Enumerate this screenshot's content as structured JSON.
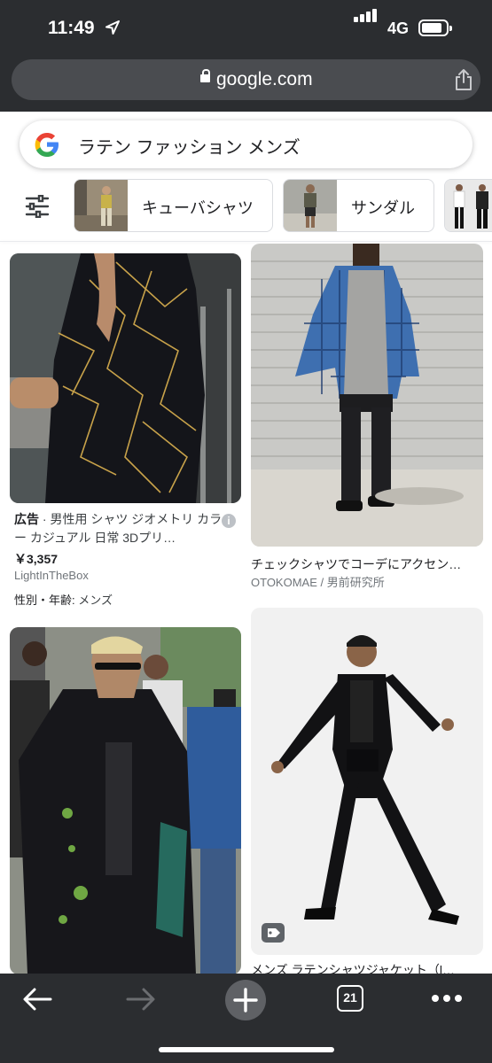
{
  "status": {
    "time": "11:49",
    "network": "4G"
  },
  "browser": {
    "url": "google.com"
  },
  "search": {
    "query": "ラテン ファッション メンズ"
  },
  "chips": [
    {
      "label": "キューバシャツ"
    },
    {
      "label": "サンダル"
    }
  ],
  "results": {
    "ad": {
      "tag": "広告",
      "separator": " · ",
      "title": "男性用 シャツ ジオメトリ カラー カジュアル 日常 3Dプリ…",
      "price": "￥3,357",
      "seller": "LightInTheBox",
      "attr_key": "性別・年齢:",
      "attr_value": "メンズ",
      "info": "i"
    },
    "item1": {
      "caption": "チェックシャツでコーデにアクセン…",
      "source": "OTOKOMAE / 男前研究所"
    },
    "item2": {
      "caption": "メンズ ラテンシャツジャケット（l…"
    }
  },
  "toolbar": {
    "tab_count": "21"
  },
  "colors": {
    "chrome": "#2b2d30",
    "urlbar": "#4a4c50",
    "text": "#202124",
    "muted": "#70757a"
  }
}
